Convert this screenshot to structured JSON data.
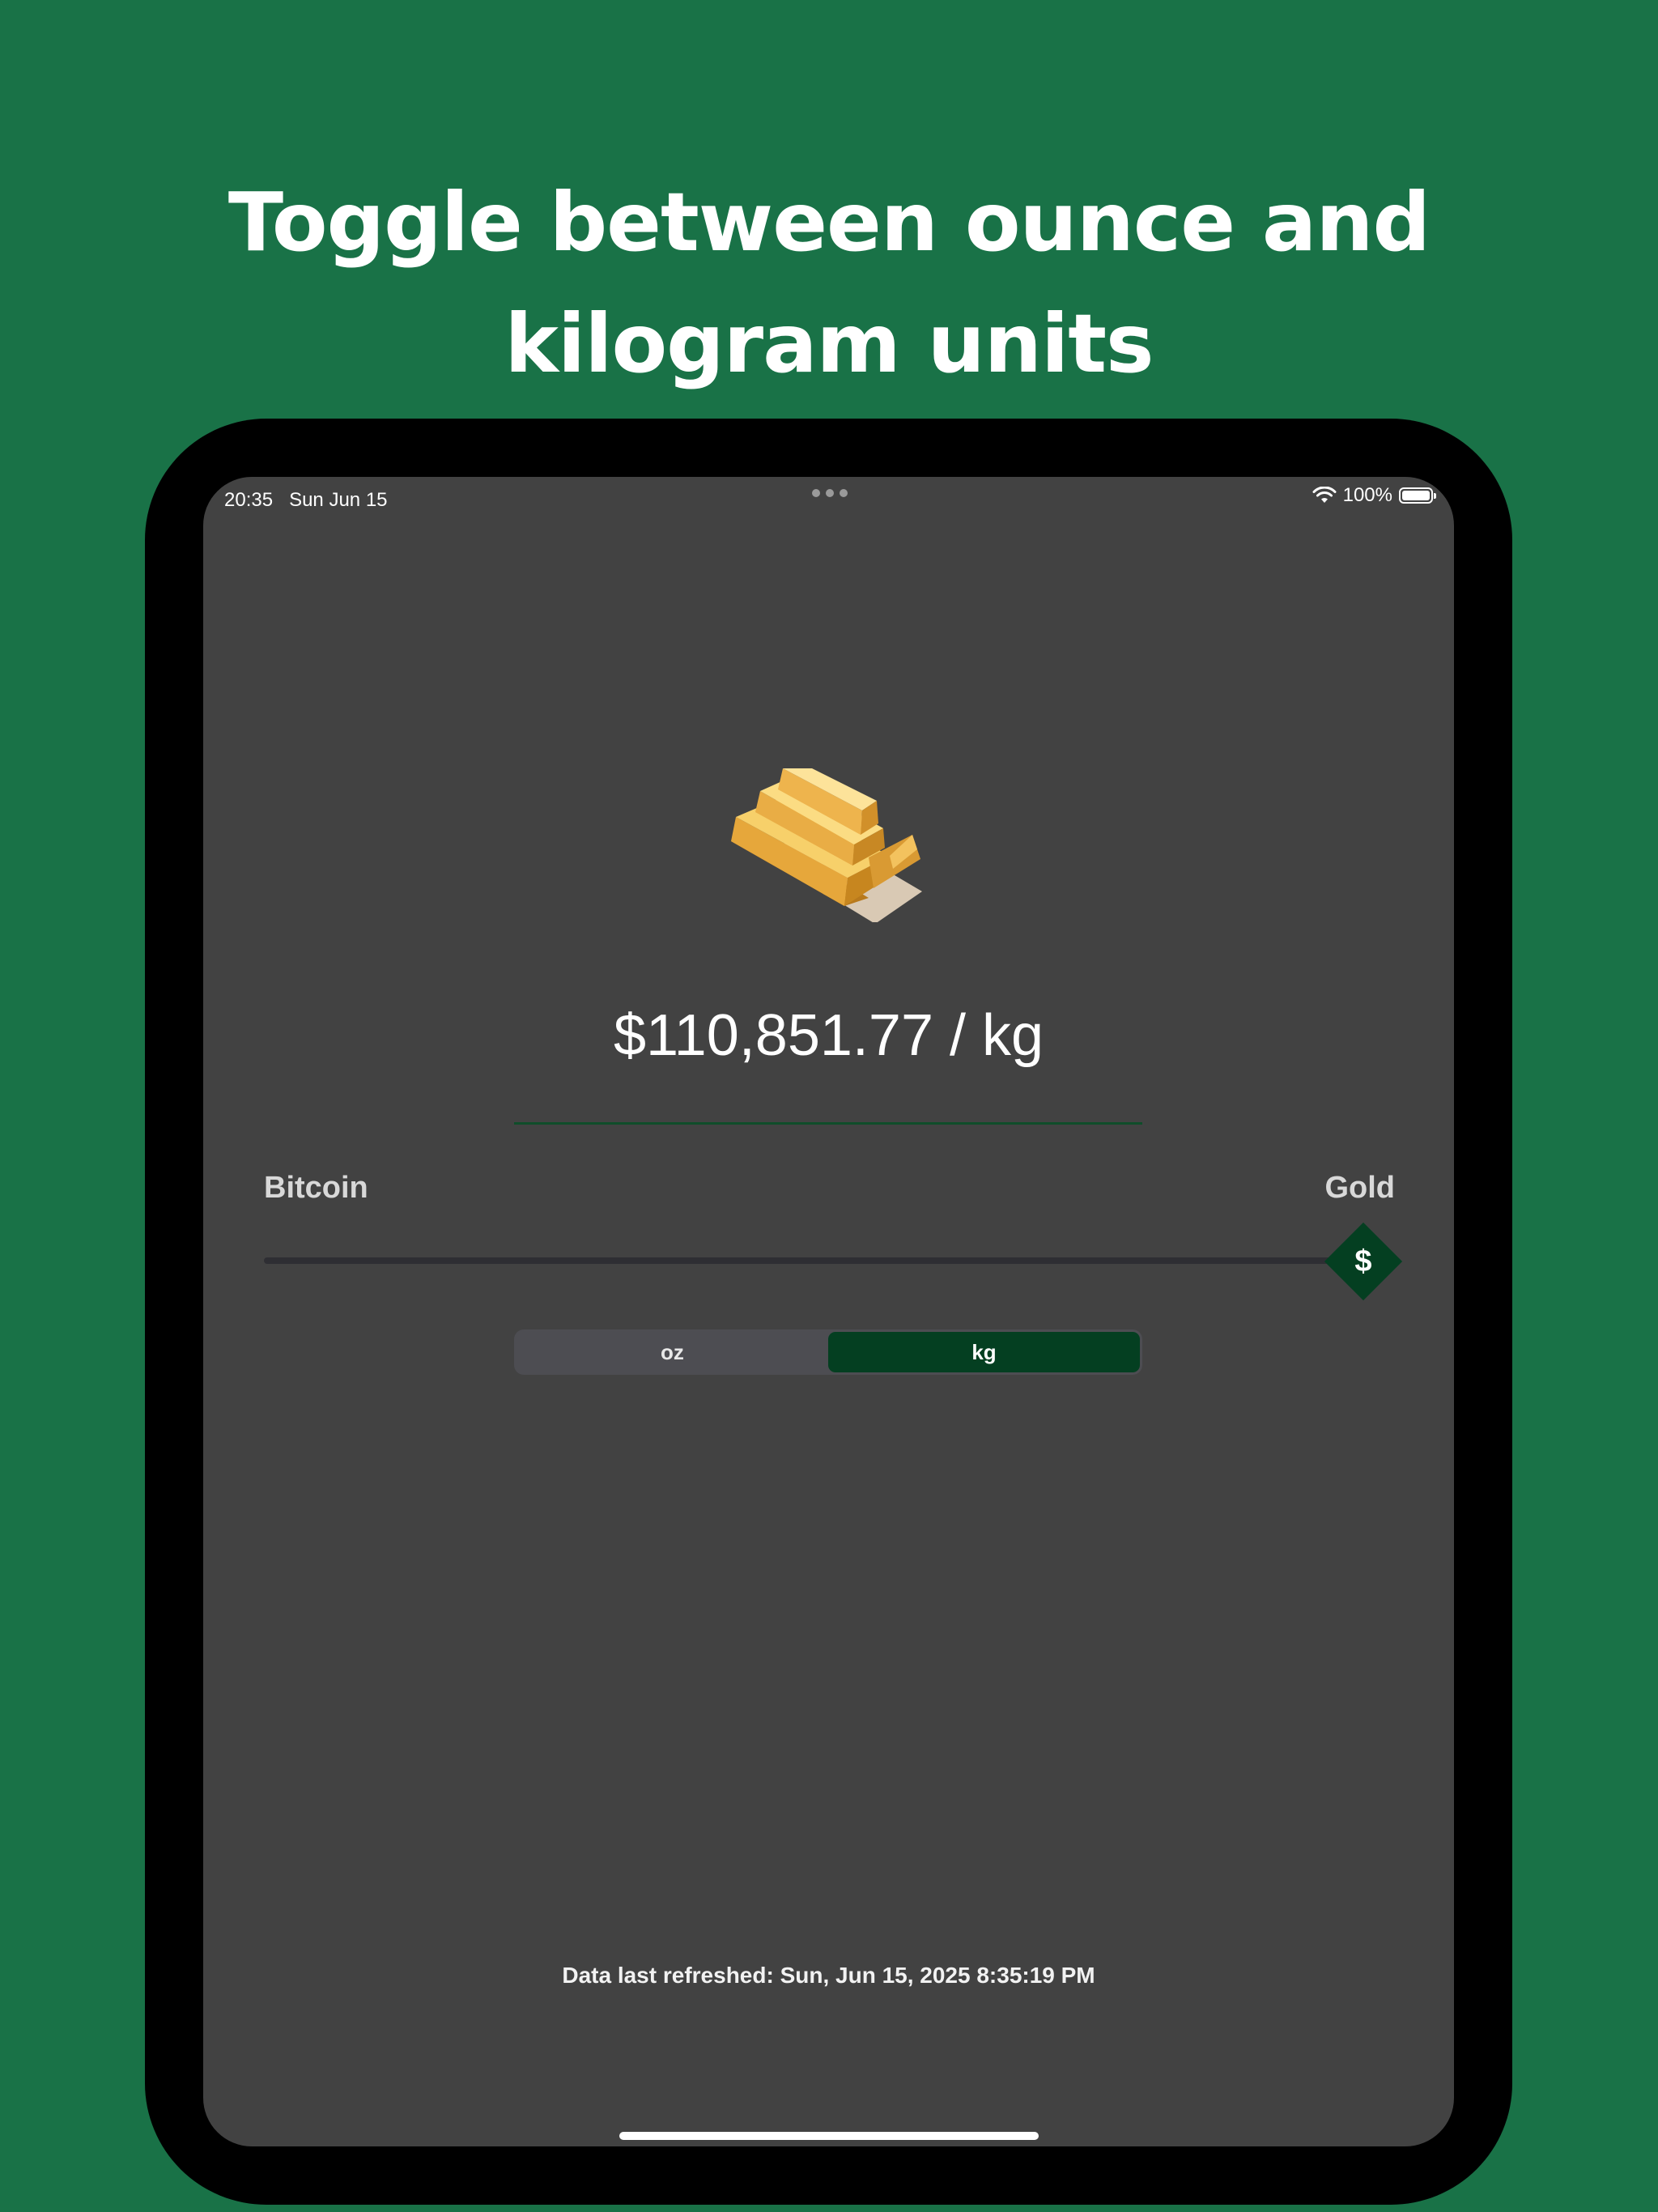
{
  "headline": {
    "line1": "Toggle between ounce and",
    "line2": "kilogram units"
  },
  "status_bar": {
    "time": "20:35",
    "date": "Sun Jun 15",
    "battery": "100%",
    "wifi_icon": "wifi-icon",
    "battery_icon": "battery-full-icon"
  },
  "main": {
    "icon": "gold-bars-icon",
    "price": "$110,851.77 / kg",
    "slider": {
      "left_label": "Bitcoin",
      "right_label": "Gold",
      "thumb_label": "$",
      "value": 1.0
    },
    "unit_toggle": {
      "options": [
        "oz",
        "kg"
      ],
      "selected": "kg"
    },
    "refresh_text": "Data last refreshed: Sun, Jun 15, 2025 8:35:19 PM"
  },
  "colors": {
    "background": "#197247",
    "screen": "#424242",
    "accent": "#043f21",
    "divider": "#0f4d2a"
  }
}
